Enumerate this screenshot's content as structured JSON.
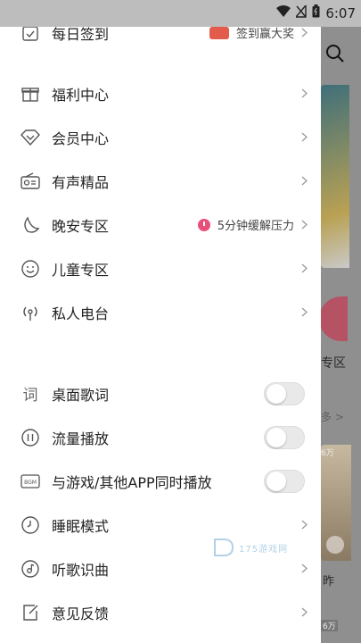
{
  "status_bar": {
    "time": "6:07"
  },
  "menu_section_1": [
    {
      "name": "daily-checkin",
      "label": "每日签到",
      "extra": "签到赢大奖"
    },
    {
      "name": "benefits-center",
      "label": "福利中心"
    },
    {
      "name": "vip-center",
      "label": "会员中心"
    },
    {
      "name": "audio-premium",
      "label": "有声精品"
    },
    {
      "name": "goodnight-zone",
      "label": "晚安专区",
      "extra": "5分钟缓解压力"
    },
    {
      "name": "kids-zone",
      "label": "儿童专区"
    },
    {
      "name": "private-radio",
      "label": "私人电台"
    }
  ],
  "menu_section_2": [
    {
      "name": "desktop-lyrics",
      "label": "桌面歌词",
      "toggle": false
    },
    {
      "name": "mobile-data-play",
      "label": "流量播放",
      "toggle": false
    },
    {
      "name": "play-with-apps",
      "label": "与游戏/其他APP同时播放",
      "toggle": false
    },
    {
      "name": "sleep-mode",
      "label": "睡眠模式"
    },
    {
      "name": "song-recognition",
      "label": "听歌识曲"
    },
    {
      "name": "feedback",
      "label": "意见反馈"
    }
  ],
  "background": {
    "zone_label": "专区",
    "more_label": "多 >",
    "count_1": "6万",
    "yesterday_label": "昨",
    "count_2": "6万"
  },
  "watermark": {
    "text": "175游戏网"
  },
  "colors": {
    "accent": "#e8507a",
    "toggle_off": "#e9e9e9",
    "text": "#222222"
  }
}
